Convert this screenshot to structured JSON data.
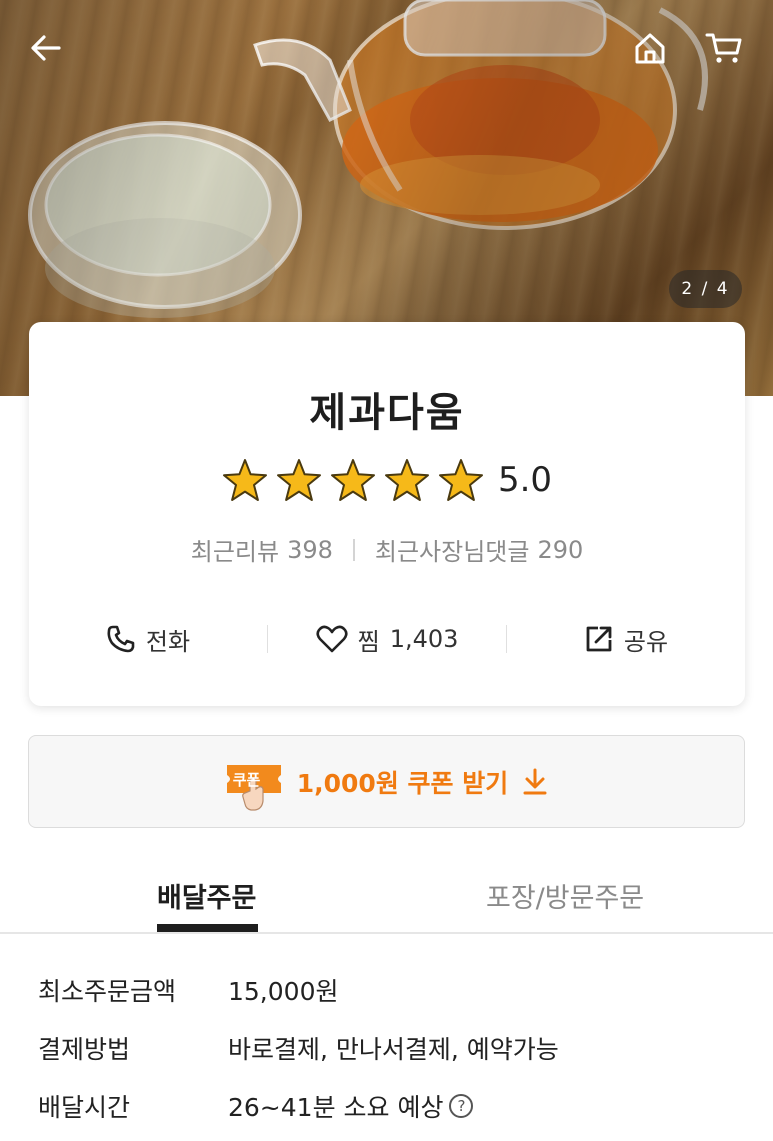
{
  "header": {
    "back_icon": "arrow-left-icon",
    "home_icon": "home-icon",
    "cart_icon": "cart-icon"
  },
  "gallery": {
    "pager": "2 / 4",
    "current": 2,
    "total": 4
  },
  "store": {
    "name": "제과다움",
    "rating": "5.0",
    "stars": 5,
    "recent_reviews_label": "최근리뷰",
    "recent_reviews_count": "398",
    "owner_replies_label": "최근사장님댓글",
    "owner_replies_count": "290"
  },
  "actions": {
    "call_label": "전화",
    "like_label": "찜",
    "like_count": "1,403",
    "share_label": "공유"
  },
  "coupon": {
    "badge": "쿠폰",
    "text": "1,000원 쿠폰 받기"
  },
  "tabs": {
    "delivery": "배달주문",
    "pickup": "포장/방문주문"
  },
  "info": {
    "min_order_label": "최소주문금액",
    "min_order_value": "15,000원",
    "payment_label": "결제방법",
    "payment_value": "바로결제, 만나서결제, 예약가능",
    "delivery_time_label": "배달시간",
    "delivery_time_value": "26~41분 소요 예상",
    "help_glyph": "?"
  },
  "colors": {
    "accent": "#f07a10",
    "star": "#f6b919",
    "text": "#222222"
  }
}
